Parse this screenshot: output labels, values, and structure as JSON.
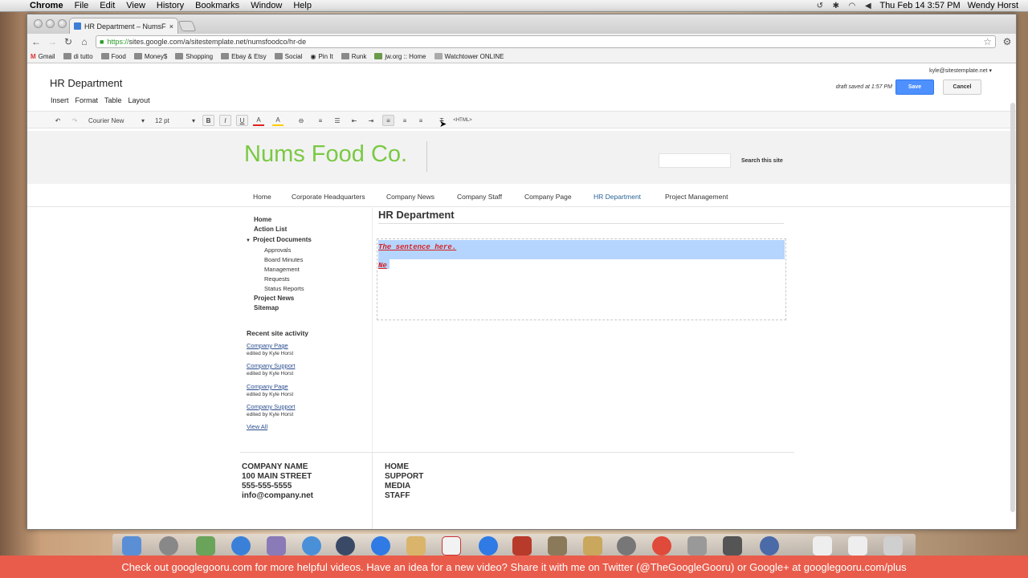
{
  "menubar": {
    "app": "Chrome",
    "items": [
      "File",
      "Edit",
      "View",
      "History",
      "Bookmarks",
      "Window",
      "Help"
    ],
    "clock": "Thu Feb 14  3:57 PM",
    "user": "Wendy Horst"
  },
  "browser": {
    "tab_title": "HR Department – NumsFood",
    "url_scheme": "https://",
    "url_rest": "sites.google.com/a/sitestemplate.net/numsfoodco/hr-de",
    "bookmarks": [
      "Gmail",
      "di tutto",
      "Food",
      "Money$",
      "Shopping",
      "Ebay & Etsy",
      "Social",
      "Pin It",
      "Runk",
      "jw.org :: Home",
      "Watchtower ONLINE"
    ]
  },
  "sites_editor": {
    "page_title": "HR Department",
    "menus": [
      "Insert",
      "Format",
      "Table",
      "Layout"
    ],
    "account": "kyle@sitestemplate.net ▾",
    "draft_note": "draft saved at 1:57 PM",
    "save_label": "Save",
    "cancel_label": "Cancel",
    "font_family": "Courier New",
    "font_size": "12 pt",
    "html_label": "<HTML>"
  },
  "site": {
    "name": "Nums Food Co.",
    "search_button": "Search this site",
    "nav": [
      "Home",
      "Corporate Headquarters",
      "Company News",
      "Company Staff",
      "Company Page",
      "HR Department",
      "Project Management"
    ],
    "active_nav": "HR Department",
    "sidebar": {
      "top": [
        "Home",
        "Action List"
      ],
      "project_documents": "Project Documents",
      "sub": [
        "Approvals",
        "Board Minutes",
        "Management",
        "Requests",
        "Status Reports"
      ],
      "bottom": [
        "Project News",
        "Sitemap"
      ]
    },
    "activity": {
      "title": "Recent site activity",
      "items": [
        {
          "page": "Company Page",
          "by": "edited by Kyle Horst"
        },
        {
          "page": "Company Support",
          "by": "edited by Kyle Horst"
        },
        {
          "page": "Company Page",
          "by": "edited by Kyle Horst"
        },
        {
          "page": "Company Support",
          "by": "edited by Kyle Horst"
        }
      ],
      "view_all": "View All"
    },
    "content": {
      "title": "HR Department",
      "line1": "The sentence here.",
      "line2": "Ne"
    },
    "footer": {
      "left": [
        "COMPANY NAME",
        "100 MAIN STREET",
        "555-555-5555",
        "info@company.net"
      ],
      "right": [
        "HOME",
        "SUPPORT",
        "MEDIA",
        "STAFF"
      ]
    }
  },
  "promo_banner": "Check out googlegooru.com for more helpful videos. Have an idea for a new video? Share it with me on Twitter (@TheGoogleGooru) or Google+ at googlegooru.com/plus"
}
